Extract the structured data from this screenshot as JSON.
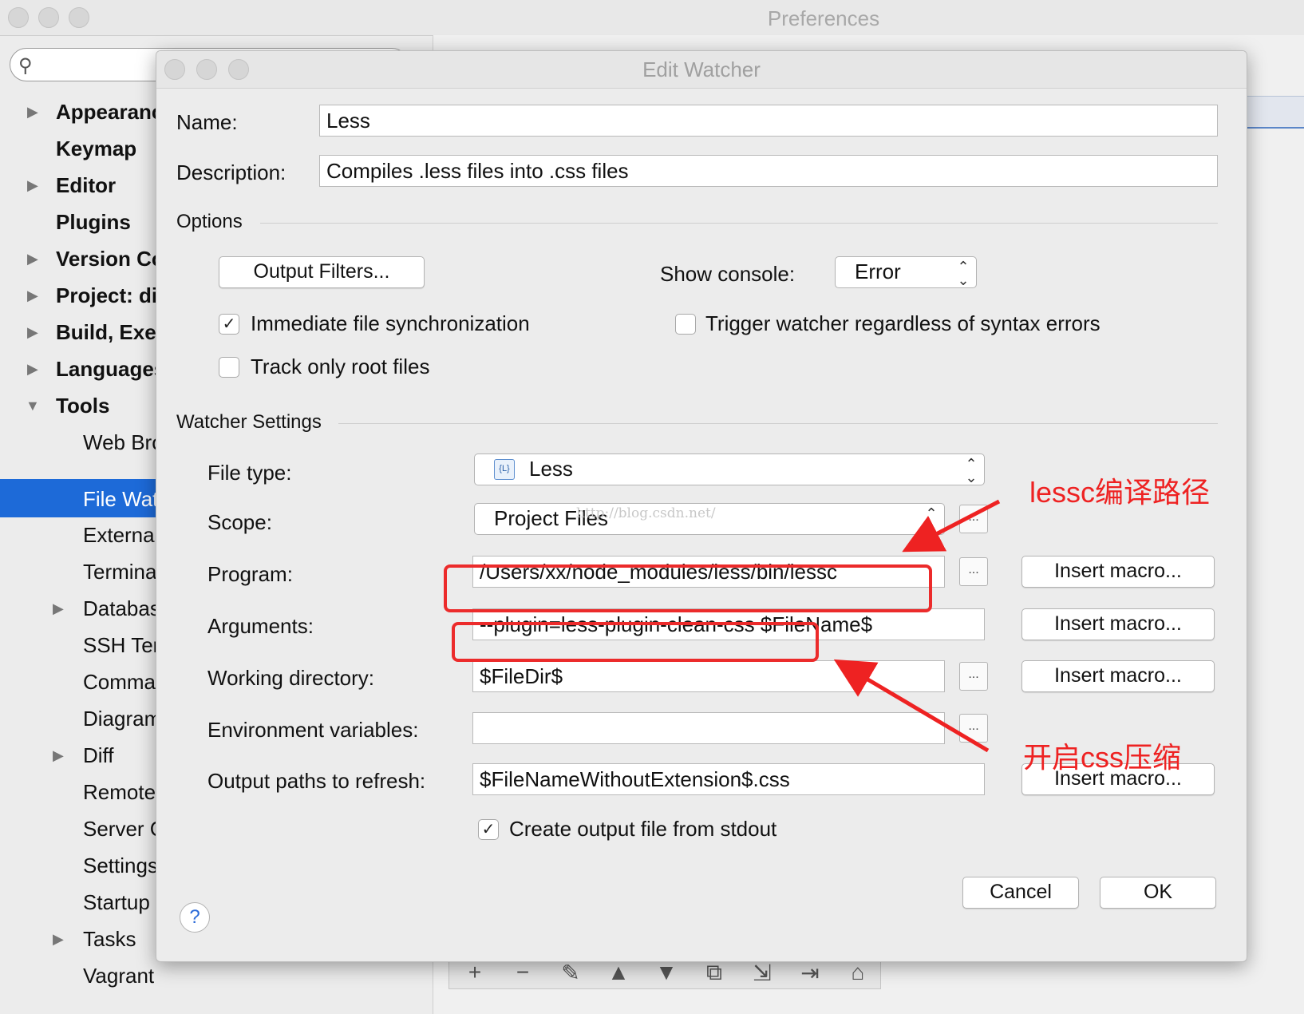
{
  "window": {
    "title": "Preferences"
  },
  "sidebar": {
    "items": [
      {
        "label": "Appearance & Behavior",
        "expandable": true
      },
      {
        "label": "Keymap",
        "expandable": false
      },
      {
        "label": "Editor",
        "expandable": true
      },
      {
        "label": "Plugins",
        "expandable": false
      },
      {
        "label": "Version Control",
        "expandable": true
      },
      {
        "label": "Project: di",
        "expandable": true
      },
      {
        "label": "Build, Execution, Deployment",
        "expandable": true
      },
      {
        "label": "Languages & Frameworks",
        "expandable": true
      },
      {
        "label": "Tools",
        "expandable": true,
        "expanded": true
      }
    ],
    "tools_children": [
      {
        "label": "Web Browsers"
      },
      {
        "label": "File Watchers",
        "selected": true
      },
      {
        "label": "External Tools"
      },
      {
        "label": "Terminal"
      },
      {
        "label": "Database",
        "expandable": true
      },
      {
        "label": "SSH Terminal"
      },
      {
        "label": "Command Line Tool Support"
      },
      {
        "label": "Diagrams"
      },
      {
        "label": "Diff",
        "expandable": true
      },
      {
        "label": "Remote SSH External Tools"
      },
      {
        "label": "Server Certificates"
      },
      {
        "label": "Settings Repository"
      },
      {
        "label": "Startup Tasks"
      },
      {
        "label": "Tasks",
        "expandable": true
      },
      {
        "label": "Vagrant"
      }
    ]
  },
  "toolbar": {
    "buttons": [
      "+",
      "−",
      "✎",
      "▲",
      "▼",
      "⧉",
      "⇲",
      "⇥",
      "⌂"
    ]
  },
  "dialog": {
    "title": "Edit Watcher",
    "name_label": "Name:",
    "name_value": "Less",
    "description_label": "Description:",
    "description_value": "Compiles .less files into .css files",
    "options_header": "Options",
    "output_filters_button": "Output Filters...",
    "show_console_label": "Show console:",
    "show_console_value": "Error",
    "immediate_sync_label": "Immediate file synchronization",
    "immediate_sync_checked": true,
    "trigger_label": "Trigger watcher regardless of syntax errors",
    "trigger_checked": false,
    "track_root_label": "Track only root files",
    "track_root_checked": false,
    "watcher_settings_header": "Watcher Settings",
    "file_type_label": "File type:",
    "file_type_value": "Less",
    "scope_label": "Scope:",
    "scope_value": "Project Files",
    "program_label": "Program:",
    "program_value": "/Users/xx/node_modules/less/bin/lessc",
    "arguments_label": "Arguments:",
    "arguments_value": "--plugin=less-plugin-clean-css $FileName$",
    "working_dir_label": "Working directory:",
    "working_dir_value": "$FileDir$",
    "env_label": "Environment variables:",
    "env_value": "",
    "output_paths_label": "Output paths to refresh:",
    "output_paths_value": "$FileNameWithoutExtension$.css",
    "create_output_label": "Create output file from stdout",
    "create_output_checked": true,
    "insert_macro_label": "Insert macro...",
    "dots_label": "...",
    "help_label": "?",
    "cancel_label": "Cancel",
    "ok_label": "OK"
  },
  "annotations": {
    "lessc_path": "lessc编译路径",
    "enable_css_compress": "开启css压缩",
    "color": "#ee2222"
  },
  "watermark": "http://blog.csdn.net/"
}
